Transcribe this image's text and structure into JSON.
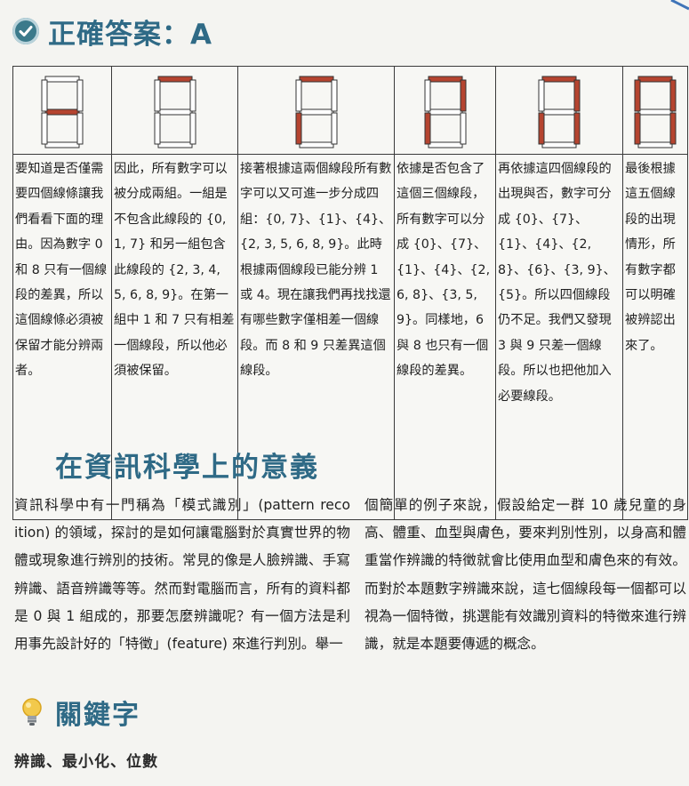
{
  "header": {
    "title": "正確答案：A",
    "icon": "check-circle-icon"
  },
  "colors": {
    "accent": "#2f6a86",
    "segment_on": "#b5442f",
    "segment_off": "#ffffff",
    "border": "#3a3a3a"
  },
  "steps": [
    {
      "segments": [
        "g"
      ],
      "text": "要知道是否僅需要四個線條讓我們看看下面的理由。因為數字 0 和 8 只有一個線段的差異，所以這個線條必須被保留才能分辨兩者。"
    },
    {
      "segments": [
        "a"
      ],
      "text": "因此，所有數字可以被分成兩組。一組是不包含此線段的 {0, 1, 7} 和另一組包含此線段的 {2, 3, 4, 5, 6, 8, 9}。在第一組中 1 和 7 只有相差一個線段，所以他必須被保留。"
    },
    {
      "segments": [
        "a",
        "e"
      ],
      "text": "接著根據這兩個線段所有數字可以又可進一步分成四組：{0, 7}、{1}、{4}、{2, 3, 5, 6, 8, 9}。此時根據兩個線段已能分辨 1 或 4。現在讓我們再找找還有哪些數字僅相差一個線段。而 8 和 9 只差異這個線段。"
    },
    {
      "segments": [
        "a",
        "e",
        "b"
      ],
      "text": "依據是否包含了這個三個線段，所有數字可以分成 {0}、{7}、{1}、{4}、{2, 6, 8}、{3, 5, 9}。同樣地，6 與 8 也只有一個線段的差異。"
    },
    {
      "segments": [
        "a",
        "e",
        "b",
        "c"
      ],
      "text": "再依據這四個線段的出現與否，數字可分成 {0}、{7}、{1}、{4}、{2, 8}、{6}、{3, 9}、{5}。所以四個線段仍不足。我們又發現 3 與 9 只差一個線段。所以也把他加入必要線段。"
    },
    {
      "segments": [
        "a",
        "e",
        "b",
        "c",
        "f"
      ],
      "text": "最後根據這五個線段的出現情形，所有數字都可以明確被辨認出來了。"
    }
  ],
  "section": {
    "title": "在資訊科學上的意義",
    "paragraph_left": "資訊科學中有一門稱為「模式識別」(pattern reco ition) 的領域，探討的是如何讓電腦對於真實世界的物體或現象進行辨別的技術。常見的像是人臉辨識、手寫辨識、語音辨識等等。然而對電腦而言，所有的資料都是 0 與 1 組成的，那要怎麼辨識呢？有一個方法是利用事先設計好的「特徵」(feature) 來進行判別。舉一",
    "paragraph_right": "個簡單的例子來說，假設給定一群 10 歲兒童的身高、體重、血型與膚色，要來判別性別，以身高和體重當作辨識的特徵就會比使用血型和膚色來的有效。而對於本題數字辨識來說，這七個線段每一個都可以視為一個特徵，挑選能有效識別資料的特徵來進行辨識，就是本題要傳遞的概念。"
  },
  "keywords": {
    "title": "關鍵字",
    "icon": "lightbulb-icon",
    "list": "辨識、最小化、位數"
  }
}
